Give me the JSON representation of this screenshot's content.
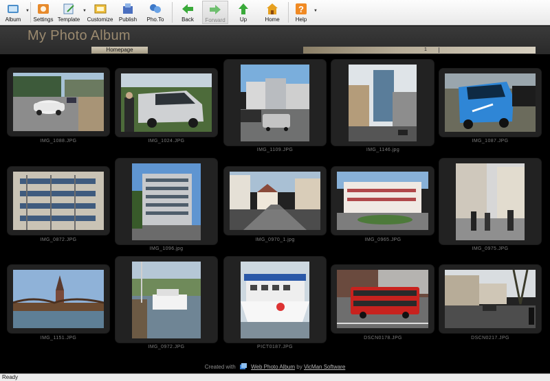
{
  "toolbar": {
    "buttons": [
      {
        "label": "Album",
        "icon": "album-icon",
        "dropdown": true
      },
      {
        "label": "Settings",
        "icon": "settings-icon",
        "dropdown": false
      },
      {
        "label": "Template",
        "icon": "template-icon",
        "dropdown": true
      },
      {
        "label": "Customize",
        "icon": "customize-icon",
        "dropdown": false
      },
      {
        "label": "Publish",
        "icon": "publish-icon",
        "dropdown": false
      },
      {
        "label": "Pho.To",
        "icon": "photo-icon",
        "dropdown": false
      },
      {
        "label": "Back",
        "icon": "back-arrow-icon",
        "dropdown": false
      },
      {
        "label": "Forward",
        "icon": "forward-arrow-icon",
        "dropdown": false,
        "disabled": true
      },
      {
        "label": "Up",
        "icon": "up-arrow-icon",
        "dropdown": false
      },
      {
        "label": "Home",
        "icon": "home-icon",
        "dropdown": false
      },
      {
        "label": "Help",
        "icon": "help-icon",
        "dropdown": true
      }
    ]
  },
  "header": {
    "title": "My Photo Album",
    "home_tab": "Homepage",
    "page_number": "1"
  },
  "photos": [
    {
      "caption": "IMG_1088.JPG",
      "icon": "photo-street-car-icon"
    },
    {
      "caption": "IMG_1024.JPG",
      "icon": "photo-van-icon"
    },
    {
      "caption": "IMG_1109.JPG",
      "icon": "photo-city-street-icon"
    },
    {
      "caption": "IMG_1146.jpg",
      "icon": "photo-tower-icon"
    },
    {
      "caption": "IMG_1087.JPG",
      "icon": "photo-smart-car-icon"
    },
    {
      "caption": "IMG_0872.JPG",
      "icon": "photo-shelves-icon"
    },
    {
      "caption": "IMG_1096.jpg",
      "icon": "photo-building-icon"
    },
    {
      "caption": "IMG_0970_1.jpg",
      "icon": "photo-town-street-icon"
    },
    {
      "caption": "IMG_0965.JPG",
      "icon": "photo-plaza-icon"
    },
    {
      "caption": "IMG_0975.JPG",
      "icon": "photo-people-street-icon"
    },
    {
      "caption": "IMG_1151.JPG",
      "icon": "photo-bridge-church-icon"
    },
    {
      "caption": "IMG_0972.JPG",
      "icon": "photo-boat-river-icon"
    },
    {
      "caption": "PICT0187.JPG",
      "icon": "photo-ferry-icon"
    },
    {
      "caption": "DSCN0178.JPG",
      "icon": "photo-red-bus-icon"
    },
    {
      "caption": "DSCN0217.JPG",
      "icon": "photo-avenue-icon"
    }
  ],
  "footer": {
    "prefix": "Created with",
    "app_link": "Web Photo Album",
    "by": "by",
    "company_link": "VicMan Software"
  },
  "status": "Ready",
  "colors": {
    "title": "#9b8a6f",
    "background": "#000000",
    "frame": "#222222"
  }
}
